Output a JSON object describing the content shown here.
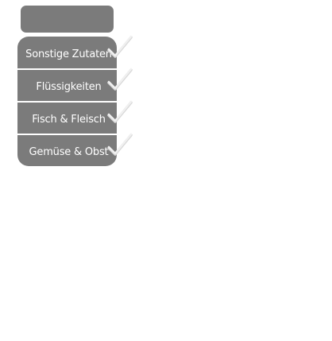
{
  "menu": {
    "items": [
      {
        "label": "Sonstige Zutaten",
        "icon": "check-icon"
      },
      {
        "label": "Flüssigkeiten",
        "icon": "check-icon"
      },
      {
        "label": "Fisch & Fleisch",
        "icon": "check-icon"
      },
      {
        "label": "Gemüse & Obst",
        "icon": "check-icon"
      }
    ]
  },
  "colors": {
    "item_bg": "#7b7b7b",
    "item_text": "#ffffff",
    "check": "#f0f0f0",
    "check_shadow": "#d7d7d7"
  }
}
